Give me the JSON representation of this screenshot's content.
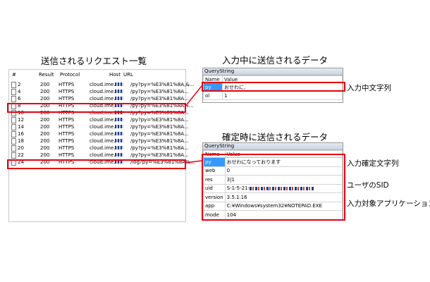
{
  "captions": {
    "request_list": "送信されるリクエスト一覧",
    "input_data": "入力中に送信されるデータ",
    "confirm_data": "確定時に送信されるデータ"
  },
  "request_list": {
    "columns": [
      "#",
      "Result",
      "Protocol",
      "Host",
      "URL"
    ],
    "rows": [
      {
        "num": "2",
        "result": "200",
        "protocol": "HTTPS",
        "host": "cloud.ime.",
        "url": "/py?py=%E3%81%8A,&..."
      },
      {
        "num": "4",
        "result": "200",
        "protocol": "HTTPS",
        "host": "cloud.ime.",
        "url": "/py?py=%E3%81%8A..."
      },
      {
        "num": "6",
        "result": "200",
        "protocol": "HTTPS",
        "host": "cloud.ime.",
        "url": "/py?py=%E3%81%8A..."
      },
      {
        "num": "8",
        "result": "200",
        "protocol": "HTTPS",
        "host": "cloud.ime.",
        "url": "/py?py=%E3%81%8A%..."
      },
      {
        "num": "10",
        "result": "200",
        "protocol": "HTTPS",
        "host": "cloud.ime.",
        "url": "/py?py=%E3%81%8A..."
      },
      {
        "num": "12",
        "result": "200",
        "protocol": "HTTPS",
        "host": "cloud.ime.",
        "url": "/py?py=%E3%81%8A..."
      },
      {
        "num": "14",
        "result": "200",
        "protocol": "HTTPS",
        "host": "cloud.ime.",
        "url": "/py?py=%E3%81%8A..."
      },
      {
        "num": "16",
        "result": "200",
        "protocol": "HTTPS",
        "host": "cloud.ime.",
        "url": "/py?py=%E3%81%8A..."
      },
      {
        "num": "18",
        "result": "200",
        "protocol": "HTTPS",
        "host": "cloud.ime.",
        "url": "/py?py=%E3%81%8A..."
      },
      {
        "num": "20",
        "result": "200",
        "protocol": "HTTPS",
        "host": "cloud.ime.",
        "url": "/py?py=%E3%81%8A..."
      },
      {
        "num": "22",
        "result": "200",
        "protocol": "HTTPS",
        "host": "cloud.ime.",
        "url": "/py?py=%E3%81%8A..."
      },
      {
        "num": "24",
        "result": "200",
        "protocol": "HTTPS",
        "host": "cloud.ime.",
        "url": "/log?py=%E3%81%8A%..."
      }
    ],
    "highlighted_rows": [
      "8",
      "24"
    ]
  },
  "input_panel": {
    "title": "QueryString",
    "header": {
      "name": "Name",
      "value": "Value"
    },
    "rows": [
      {
        "name": "py",
        "value": "おせわに,"
      },
      {
        "name": "ol",
        "value": "1"
      }
    ],
    "annotation": "入力中文字列"
  },
  "confirm_panel": {
    "title": "QueryString",
    "header": {
      "name": "Name",
      "value": "Value"
    },
    "rows": [
      {
        "name": "py",
        "value": "おせわになっております"
      },
      {
        "name": "web",
        "value": "0"
      },
      {
        "name": "res",
        "value": "3|1"
      },
      {
        "name": "uid",
        "value": "S-1-5-21-"
      },
      {
        "name": "version",
        "value": "3.5.1.16"
      },
      {
        "name": "app",
        "value": "C:¥Windows¥system32¥NOTEPAD.EXE"
      },
      {
        "name": "mode",
        "value": "104"
      }
    ],
    "annotations": {
      "py": "入力確定文字列",
      "uid": "ユーザのSID",
      "app": "入力対象アプリケーション"
    }
  },
  "colors": {
    "highlight": "#e60012",
    "selected": "#3399ff"
  }
}
